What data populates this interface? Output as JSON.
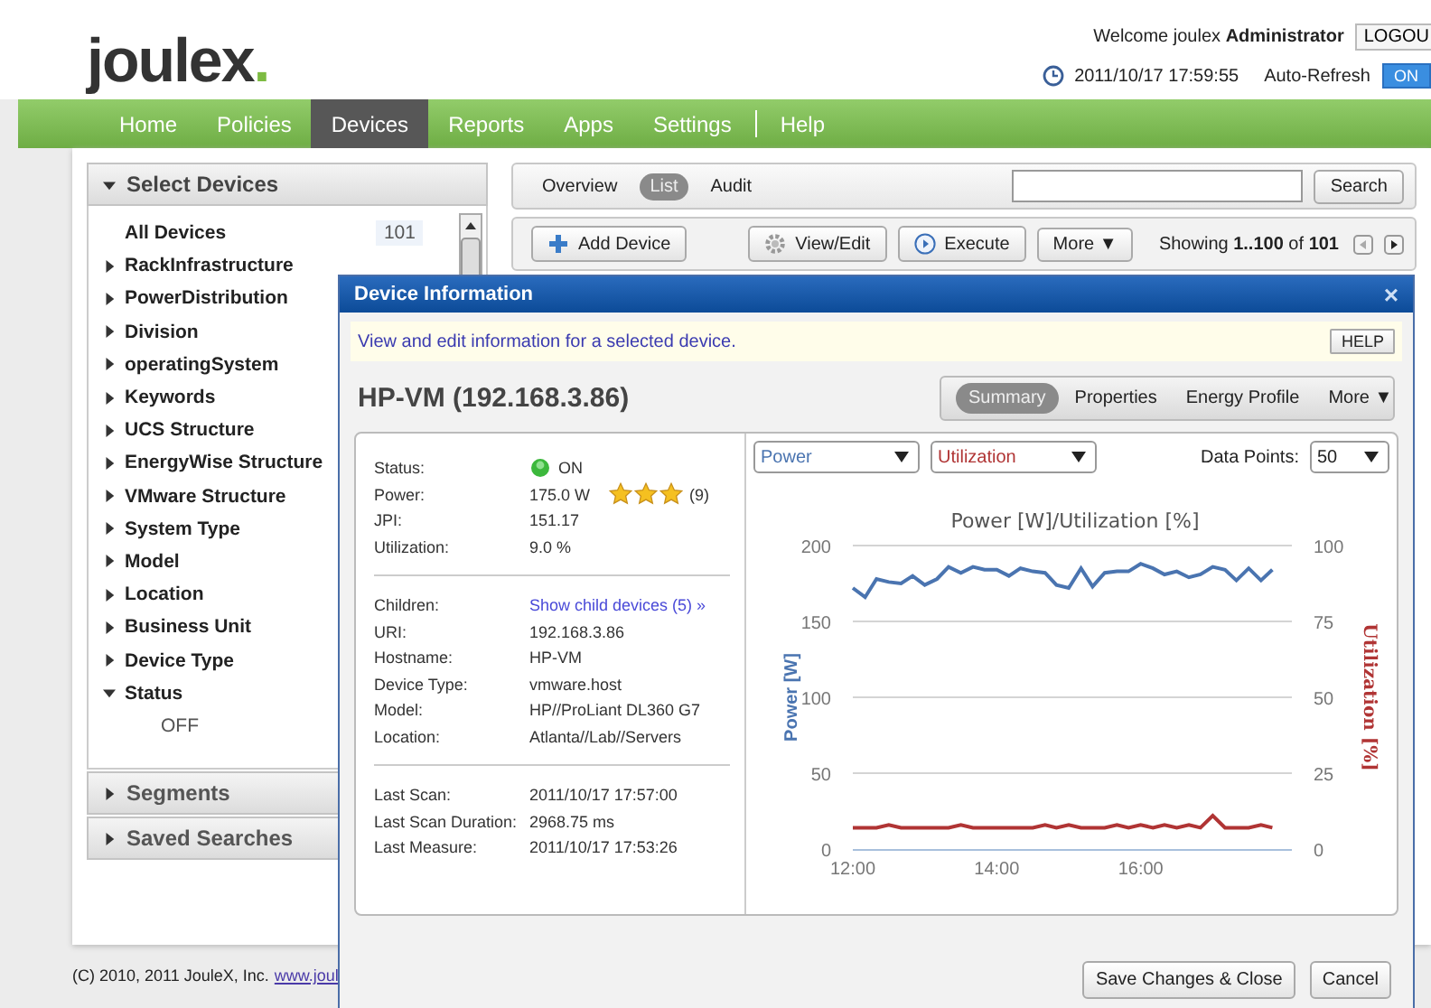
{
  "header": {
    "logo": "joulex",
    "logo_dot": ".",
    "welcome": "Welcome joulex **Administrator**",
    "logout": "LOGOU",
    "datetime": "2011/10/17 17:59:55",
    "auto_refresh": {
      "label": "Auto-Refresh",
      "toggle": "ON",
      "on": true
    }
  },
  "nav": [
    {
      "label": "Home",
      "selected": false
    },
    {
      "label": "Policies",
      "selected": false
    },
    {
      "label": "Devices",
      "selected": true
    },
    {
      "label": "Reports",
      "selected": false
    },
    {
      "label": "Apps",
      "selected": false
    },
    {
      "label": "Settings",
      "selected": false
    },
    {
      "label": "Help",
      "selected": false,
      "separator": true
    }
  ],
  "sidebar": {
    "title": "Select Devices",
    "expanded": true,
    "items": [
      {
        "label": "All Devices",
        "count": "101",
        "kind": "all"
      },
      {
        "label": "RackInfrastructure",
        "expanded": false
      },
      {
        "label": "PowerDistribution",
        "expanded": false
      },
      {
        "label": "Division",
        "expanded": false
      },
      {
        "label": "operatingSystem",
        "expanded": false
      },
      {
        "label": "Keywords",
        "expanded": false
      },
      {
        "label": "UCS Structure",
        "expanded": false
      },
      {
        "label": "EnergyWise Structure",
        "expanded": false
      },
      {
        "label": "VMware Structure",
        "expanded": false
      },
      {
        "label": "System Type",
        "expanded": false
      },
      {
        "label": "Model",
        "expanded": false
      },
      {
        "label": "Location",
        "expanded": false
      },
      {
        "label": "Business Unit",
        "expanded": false
      },
      {
        "label": "Device Type",
        "expanded": false
      },
      {
        "label": "Status",
        "expanded": true,
        "children": [
          {
            "label": "OFF"
          }
        ]
      }
    ],
    "sections": [
      {
        "label": "Segments",
        "expanded": false
      },
      {
        "label": "Saved Searches",
        "expanded": false
      }
    ]
  },
  "main": {
    "view_tabs": [
      {
        "label": "Overview",
        "selected": false
      },
      {
        "label": "List",
        "selected": true
      },
      {
        "label": "Audit",
        "selected": false
      }
    ],
    "search_button": "Search",
    "actions": [
      {
        "label": "Add Device",
        "kind": "add"
      },
      {
        "label": "View/Edit",
        "kind": "edit"
      },
      {
        "label": "Execute",
        "kind": "run"
      },
      {
        "label": "More ▼",
        "kind": "menu"
      }
    ],
    "paging": "Showing **1..100** of **101**"
  },
  "footer": {
    "copyright": "(C) 2010, 2011 JouleX, Inc.",
    "link": "www.joul"
  },
  "dialog": {
    "title": "Device Information",
    "close": "×",
    "help_text": "View and edit information for a selected device.",
    "help_button": "HELP",
    "device_title": "HP-VM (192.168.3.86)",
    "tabs": [
      {
        "label": "Summary",
        "selected": true
      },
      {
        "label": "Properties",
        "selected": false
      },
      {
        "label": "Energy Profile",
        "selected": false
      },
      {
        "label": "More ▼",
        "selected": false
      }
    ],
    "details": [
      [
        {
          "label": "Status:",
          "value": "ON",
          "kind": "status"
        },
        {
          "label": "Power:",
          "value": "175.0 W",
          "stars": 3,
          "rating_count": "(9)",
          "kind": "rating"
        },
        {
          "label": "JPI:",
          "value": "151.17"
        },
        {
          "label": "Utilization:",
          "value": "9.0 %"
        }
      ],
      [
        {
          "label": "Children:",
          "value": "Show child devices (5) »",
          "kind": "link"
        },
        {
          "label": "URI:",
          "value": "192.168.3.86"
        },
        {
          "label": "Hostname:",
          "value": "HP-VM"
        },
        {
          "label": "Device Type:",
          "value": "vmware.host"
        },
        {
          "label": "Model:",
          "value": "HP//ProLiant DL360 G7"
        },
        {
          "label": "Location:",
          "value": "Atlanta//Lab//Servers"
        }
      ],
      [
        {
          "label": "Last Scan:",
          "value": "2011/10/17 17:57:00"
        },
        {
          "label": "Last Scan Duration:",
          "value": "2968.75 ms"
        },
        {
          "label": "Last Measure:",
          "value": "2011/10/17 17:53:26"
        }
      ]
    ],
    "data_points_label": "Data Points:",
    "data_points": "50",
    "chart_data": {
      "type": "line",
      "title": "Power [W]/Utilization [%]",
      "ylabel": "Power [W]",
      "y2label": "Utilization [%]",
      "x": [
        12,
        12.17,
        12.33,
        12.5,
        12.67,
        12.83,
        13,
        13.17,
        13.33,
        13.5,
        13.67,
        13.83,
        14,
        14.17,
        14.33,
        14.5,
        14.67,
        14.83,
        15,
        15.17,
        15.33,
        15.5,
        15.67,
        15.83,
        16,
        16.17,
        16.33,
        16.5,
        16.67,
        16.83,
        17,
        17.17,
        17.33,
        17.5,
        17.67,
        17.83
      ],
      "xlim": [
        12,
        18.1
      ],
      "ylim": [
        0,
        200
      ],
      "y2lim": [
        0,
        100
      ],
      "xticks": [
        {
          "value": 12,
          "label": "12:00"
        },
        {
          "value": 14,
          "label": "14:00"
        },
        {
          "value": 16,
          "label": "16:00"
        }
      ],
      "grid": true,
      "yticks": [
        0,
        50,
        100,
        150,
        200
      ],
      "y2ticks": [
        0,
        25,
        50,
        75,
        100
      ],
      "series": [
        {
          "name": "Power",
          "color": "#4a74b0",
          "values": [
            172,
            166,
            178,
            176,
            175,
            180,
            174,
            178,
            186,
            182,
            186,
            184,
            184,
            180,
            185,
            183,
            182,
            174,
            172,
            185,
            173,
            182,
            183,
            183,
            188,
            185,
            181,
            183,
            179,
            181,
            186,
            184,
            177,
            185,
            177,
            184
          ]
        },
        {
          "name": "Utilization",
          "color": "#b03434",
          "axis": "y2",
          "values": [
            7,
            7,
            7,
            8,
            7,
            7,
            7,
            7,
            7,
            8,
            7,
            7,
            7,
            7,
            7,
            7,
            8,
            7,
            8,
            7,
            7,
            7,
            8,
            7,
            8,
            7,
            8,
            7,
            8,
            7,
            11,
            7,
            7,
            7,
            8,
            7
          ]
        }
      ]
    },
    "buttons": [
      "Save Changes & Close",
      "Cancel"
    ]
  }
}
